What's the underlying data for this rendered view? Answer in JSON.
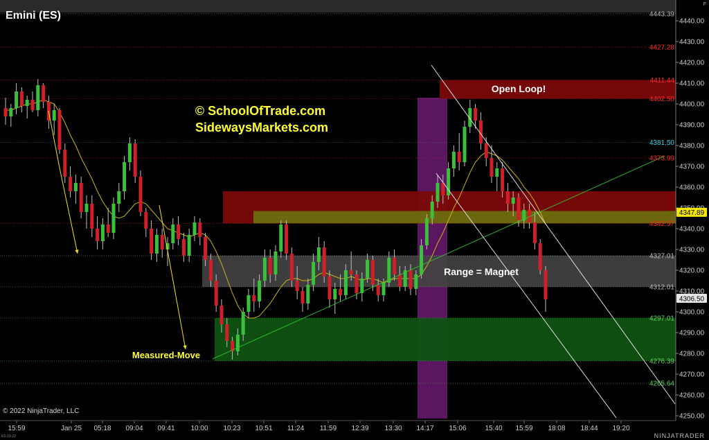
{
  "window": {
    "title": "Emini (ES)",
    "copyright": "© 2022 NinjaTrader, LLC",
    "brand": "NINJATRADER",
    "micro": "ES 03-22",
    "corner": "F"
  },
  "colors": {
    "background": "#000000",
    "up": "#3cbf3c",
    "down": "#d11f2a",
    "wick": "#bfbfbf",
    "sma": "#c8b416",
    "watermark": "#ffff33",
    "resistance_zone": "#7a0808",
    "olive_zone": "#6b6b10",
    "range_zone": "#444444",
    "support_zone": "#0f5212",
    "purple_band": "#6a1a6e",
    "trendline": "#33cc33",
    "channel": "#e0e0e0",
    "arrow": "#f2e418"
  },
  "chart_data": {
    "type": "candlestick",
    "title": "Emini (ES)",
    "xlabel": "",
    "ylabel": "",
    "ylim": [
      4248,
      4448
    ],
    "x_tick_labels": [
      "15:59",
      "Jan 25",
      "05:18",
      "09:04",
      "09:41",
      "10:00",
      "10:23",
      "10:51",
      "11:24",
      "11:59",
      "12:39",
      "13:30",
      "14:17",
      "15:06",
      "15:40",
      "15:59",
      "18:08",
      "18:44",
      "19:20"
    ],
    "y_ticks": [
      4250,
      4260,
      4270,
      4280,
      4290,
      4300,
      4310,
      4320,
      4330,
      4340,
      4350,
      4360,
      4370,
      4380,
      4390,
      4400,
      4410,
      4420,
      4430,
      4440
    ],
    "y_tick_labels": [
      "4250.00",
      "4260.00",
      "4270.00",
      "4280.00",
      "4290.00",
      "4300.00",
      "4310.00",
      "4320.00",
      "4330.00",
      "4340.00",
      "4350.00",
      "4360.00",
      "4370.00",
      "4380.00",
      "4390.00",
      "4400.00",
      "4410.00",
      "4420.00",
      "4430.00",
      "4440.00"
    ],
    "candles": [
      [
        4398,
        4403,
        4390,
        4394
      ],
      [
        4394,
        4400,
        4389,
        4398
      ],
      [
        4398,
        4410,
        4395,
        4406
      ],
      [
        4406,
        4408,
        4396,
        4399
      ],
      [
        4399,
        4404,
        4393,
        4402
      ],
      [
        4402,
        4406,
        4396,
        4397
      ],
      [
        4397,
        4412,
        4394,
        4409
      ],
      [
        4409,
        4410,
        4398,
        4401
      ],
      [
        4401,
        4404,
        4388,
        4392
      ],
      [
        4392,
        4400,
        4385,
        4397
      ],
      [
        4397,
        4398,
        4376,
        4378
      ],
      [
        4378,
        4381,
        4362,
        4365
      ],
      [
        4365,
        4370,
        4355,
        4358
      ],
      [
        4358,
        4366,
        4352,
        4362
      ],
      [
        4362,
        4365,
        4345,
        4348
      ],
      [
        4348,
        4356,
        4340,
        4352
      ],
      [
        4352,
        4356,
        4336,
        4340
      ],
      [
        4340,
        4346,
        4330,
        4334
      ],
      [
        4334,
        4345,
        4330,
        4342
      ],
      [
        4342,
        4350,
        4336,
        4338
      ],
      [
        4338,
        4355,
        4335,
        4352
      ],
      [
        4352,
        4362,
        4348,
        4358
      ],
      [
        4358,
        4375,
        4354,
        4372
      ],
      [
        4372,
        4384,
        4368,
        4381
      ],
      [
        4381,
        4383,
        4362,
        4365
      ],
      [
        4365,
        4368,
        4346,
        4348
      ],
      [
        4348,
        4350,
        4336,
        4340
      ],
      [
        4340,
        4344,
        4325,
        4328
      ],
      [
        4328,
        4340,
        4324,
        4337
      ],
      [
        4337,
        4340,
        4326,
        4330
      ],
      [
        4330,
        4336,
        4322,
        4333
      ],
      [
        4333,
        4345,
        4330,
        4342
      ],
      [
        4342,
        4346,
        4332,
        4335
      ],
      [
        4335,
        4338,
        4324,
        4327
      ],
      [
        4327,
        4340,
        4324,
        4337
      ],
      [
        4337,
        4346,
        4334,
        4343
      ],
      [
        4343,
        4345,
        4332,
        4336
      ],
      [
        4336,
        4338,
        4322,
        4325
      ],
      [
        4325,
        4328,
        4312,
        4315
      ],
      [
        4315,
        4318,
        4300,
        4303
      ],
      [
        4303,
        4306,
        4290,
        4294
      ],
      [
        4294,
        4297,
        4283,
        4286
      ],
      [
        4286,
        4288,
        4277,
        4281
      ],
      [
        4281,
        4292,
        4279,
        4289
      ],
      [
        4289,
        4302,
        4286,
        4300
      ],
      [
        4300,
        4311,
        4297,
        4308
      ],
      [
        4308,
        4316,
        4300,
        4305
      ],
      [
        4305,
        4318,
        4302,
        4315
      ],
      [
        4315,
        4330,
        4312,
        4326
      ],
      [
        4326,
        4330,
        4314,
        4318
      ],
      [
        4318,
        4332,
        4315,
        4329
      ],
      [
        4329,
        4344,
        4326,
        4342
      ],
      [
        4342,
        4344,
        4325,
        4328
      ],
      [
        4328,
        4331,
        4312,
        4315
      ],
      [
        4315,
        4322,
        4306,
        4310
      ],
      [
        4310,
        4312,
        4300,
        4304
      ],
      [
        4304,
        4316,
        4301,
        4313
      ],
      [
        4313,
        4328,
        4310,
        4324
      ],
      [
        4324,
        4336,
        4320,
        4331
      ],
      [
        4331,
        4334,
        4314,
        4317
      ],
      [
        4317,
        4320,
        4302,
        4306
      ],
      [
        4306,
        4314,
        4299,
        4311
      ],
      [
        4311,
        4318,
        4305,
        4308
      ],
      [
        4308,
        4323,
        4306,
        4320
      ],
      [
        4320,
        4329,
        4315,
        4318
      ],
      [
        4318,
        4320,
        4306,
        4309
      ],
      [
        4309,
        4319,
        4305,
        4316
      ],
      [
        4316,
        4328,
        4314,
        4325
      ],
      [
        4325,
        4327,
        4310,
        4313
      ],
      [
        4313,
        4316,
        4305,
        4308
      ],
      [
        4308,
        4316,
        4305,
        4314
      ],
      [
        4314,
        4329,
        4312,
        4326
      ],
      [
        4326,
        4330,
        4315,
        4318
      ],
      [
        4318,
        4322,
        4310,
        4312
      ],
      [
        4312,
        4322,
        4310,
        4320
      ],
      [
        4320,
        4323,
        4308,
        4311
      ],
      [
        4311,
        4320,
        4308,
        4318
      ],
      [
        4318,
        4335,
        4316,
        4332
      ],
      [
        4332,
        4347,
        4330,
        4345
      ],
      [
        4345,
        4356,
        4342,
        4353
      ],
      [
        4353,
        4366,
        4350,
        4362
      ],
      [
        4362,
        4366,
        4352,
        4356
      ],
      [
        4356,
        4372,
        4354,
        4369
      ],
      [
        4369,
        4380,
        4365,
        4377
      ],
      [
        4377,
        4386,
        4368,
        4372
      ],
      [
        4372,
        4392,
        4370,
        4389
      ],
      [
        4389,
        4402,
        4386,
        4398
      ],
      [
        4398,
        4400,
        4388,
        4392
      ],
      [
        4392,
        4396,
        4378,
        4381
      ],
      [
        4381,
        4384,
        4370,
        4374
      ],
      [
        4374,
        4380,
        4362,
        4365
      ],
      [
        4365,
        4372,
        4358,
        4369
      ],
      [
        4369,
        4372,
        4355,
        4358
      ],
      [
        4358,
        4362,
        4348,
        4352
      ],
      [
        4352,
        4358,
        4346,
        4355
      ],
      [
        4355,
        4357,
        4341,
        4344
      ],
      [
        4344,
        4352,
        4340,
        4349
      ],
      [
        4349,
        4352,
        4340,
        4343
      ],
      [
        4343,
        4348,
        4330,
        4333
      ],
      [
        4333,
        4335,
        4318,
        4320
      ],
      [
        4320,
        4322,
        4300,
        4306
      ]
    ],
    "sma": [
      4397,
      4397,
      4398,
      4399,
      4400,
      4400,
      4401,
      4402,
      4401,
      4400,
      4396,
      4391,
      4385,
      4380,
      4374,
      4369,
      4364,
      4358,
      4353,
      4349,
      4346,
      4345,
      4346,
      4349,
      4352,
      4353,
      4352,
      4349,
      4346,
      4343,
      4340,
      4339,
      4338,
      4337,
      4336,
      4337,
      4338,
      4337,
      4334,
      4329,
      4323,
      4316,
      4309,
      4303,
      4299,
      4297,
      4297,
      4298,
      4301,
      4304,
      4308,
      4312,
      4315,
      4316,
      4316,
      4315,
      4315,
      4316,
      4318,
      4319,
      4318,
      4317,
      4316,
      4316,
      4317,
      4316,
      4315,
      4316,
      4316,
      4315,
      4314,
      4315,
      4316,
      4316,
      4316,
      4316,
      4316,
      4318,
      4322,
      4327,
      4333,
      4338,
      4344,
      4350,
      4355,
      4361,
      4367,
      4372,
      4375,
      4377,
      4376,
      4375,
      4373,
      4370,
      4367,
      4364,
      4360,
      4357,
      4353,
      4348,
      4342
    ],
    "price_levels": [
      {
        "label": "4443.39",
        "value": 4443.39,
        "color": "#bbbbbb",
        "badge": false
      },
      {
        "label": "4427.28",
        "value": 4427.28,
        "color": "#ff2a2a",
        "badge": false
      },
      {
        "label": "4411.44",
        "value": 4411.44,
        "color": "#ff2a2a",
        "badge": false
      },
      {
        "label": "4402.50",
        "value": 4402.5,
        "color": "#ff2a2a",
        "badge": false
      },
      {
        "label": "4381.50",
        "value": 4381.5,
        "color": "#2fd3e0",
        "badge": false
      },
      {
        "label": "4373.99",
        "value": 4373.99,
        "color": "#ff2a2a",
        "badge": false
      },
      {
        "label": "4347.89",
        "value": 4347.89,
        "color": "#f5e600",
        "badge": true
      },
      {
        "label": "4342.57",
        "value": 4342.57,
        "color": "#ff2a2a",
        "badge": false
      },
      {
        "label": "4327.01",
        "value": 4327.01,
        "color": "#bbbbbb",
        "badge": false
      },
      {
        "label": "4312.01",
        "value": 4312.01,
        "color": "#bbbbbb",
        "badge": false
      },
      {
        "label": "4306.50",
        "value": 4306.5,
        "color": "#e6e6e6",
        "badge": true
      },
      {
        "label": "4297.01",
        "value": 4297.01,
        "color": "#5fd45f",
        "badge": false
      },
      {
        "label": "4276.39",
        "value": 4276.39,
        "color": "#5fd45f",
        "badge": false
      },
      {
        "label": "4265.64",
        "value": 4265.64,
        "color": "#5fd45f",
        "badge": false
      }
    ],
    "zones": [
      {
        "name": "open-loop-zone",
        "label": "Open Loop!",
        "y1": 4402.5,
        "y2": 4411.44,
        "color": "#7a0808"
      },
      {
        "name": "resistance-zone",
        "label": "",
        "y1": 4342.57,
        "y2": 4358,
        "color": "#7a0808"
      },
      {
        "name": "olive-zone",
        "label": "",
        "y1": 4342.57,
        "y2": 4348.5,
        "color": "#6b6b10"
      },
      {
        "name": "range-zone",
        "label": "Range = Magnet",
        "y1": 4312.01,
        "y2": 4327.01,
        "color": "#444444"
      },
      {
        "name": "support-zone",
        "label": "",
        "y1": 4276.39,
        "y2": 4297.01,
        "color": "#0f5212"
      }
    ],
    "annotations": {
      "watermark_line1": "© SchoolOfTrade.com",
      "watermark_line2": "SidewaysMarkets.com",
      "measured_move": "Measured-Move",
      "open_loop": "Open Loop!",
      "range_magnet": "Range = Magnet"
    }
  }
}
